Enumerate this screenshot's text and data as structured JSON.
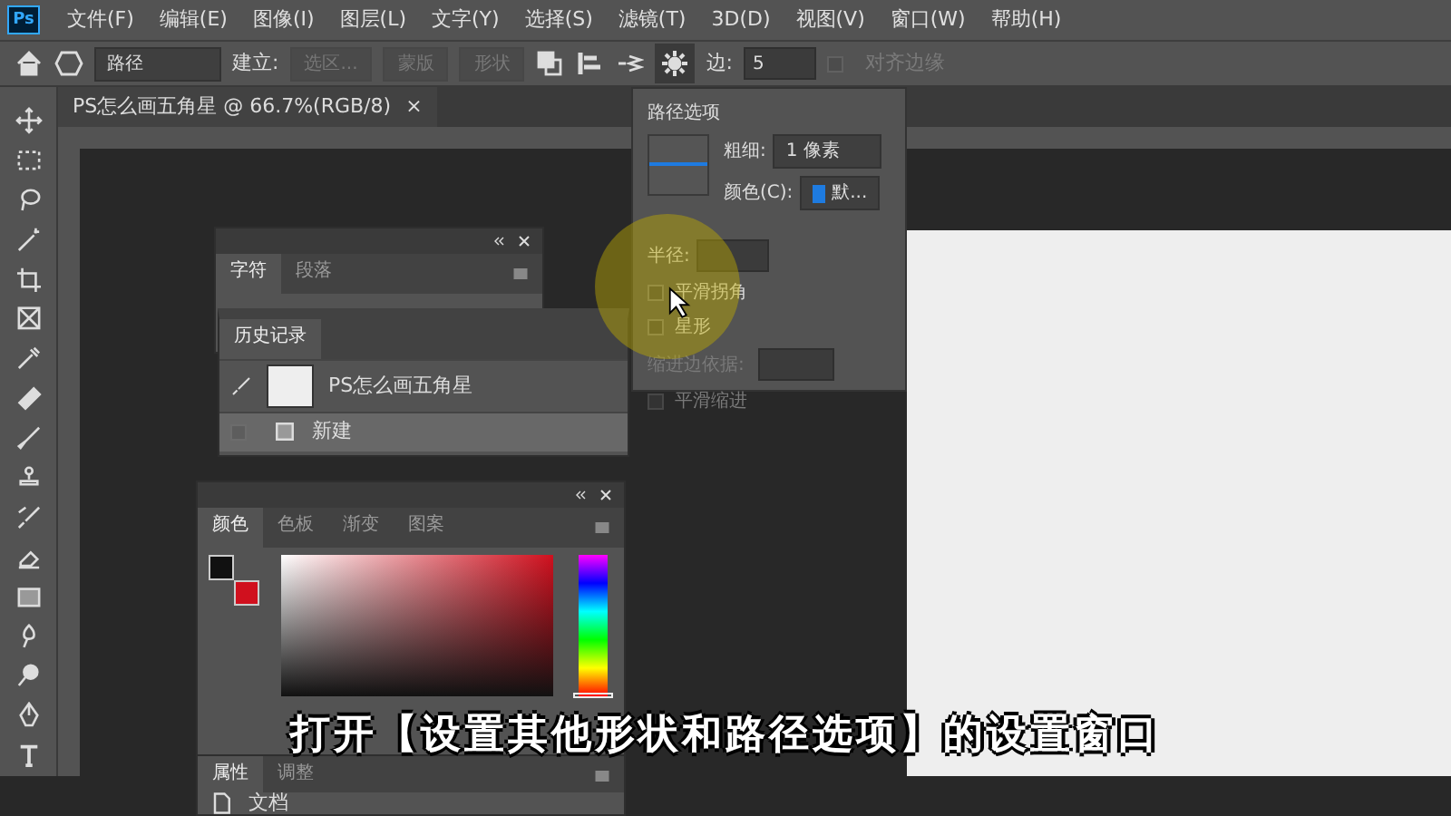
{
  "app_logo": "Ps",
  "menu": [
    "文件(F)",
    "编辑(E)",
    "图像(I)",
    "图层(L)",
    "文字(Y)",
    "选择(S)",
    "滤镜(T)",
    "3D(D)",
    "视图(V)",
    "窗口(W)",
    "帮助(H)"
  ],
  "options_bar": {
    "mode": "路径",
    "build_label": "建立:",
    "build_buttons": [
      "选区...",
      "蒙版",
      "形状"
    ],
    "sides_label": "边:",
    "sides_value": "5",
    "align_edges": {
      "label": "对齐边缘",
      "checked": false,
      "disabled": true
    }
  },
  "document_tab": {
    "title": "PS怎么画五角星 @ 66.7%(RGB/8)",
    "close": "×"
  },
  "path_options": {
    "title": "路径选项",
    "weight_label": "粗细:",
    "weight_value": "1 像素",
    "color_label": "颜色(C):",
    "color_value": "默...",
    "color": "#1e7be0",
    "radius_label": "半径:",
    "options": [
      {
        "kind": "check",
        "label": "平滑拐角",
        "checked": false,
        "disabled": false
      },
      {
        "kind": "check",
        "label": "星形",
        "checked": false,
        "disabled": false
      },
      {
        "kind": "field",
        "label": "缩进边依据:",
        "disabled": true
      },
      {
        "kind": "check",
        "label": "平滑缩进",
        "checked": false,
        "disabled": true
      }
    ]
  },
  "character_panel": {
    "tabs": [
      {
        "label": "字符",
        "selected": true
      },
      {
        "label": "段落",
        "selected": false
      }
    ]
  },
  "history_panel": {
    "tab": "历史记录",
    "entries": [
      {
        "kind": "snapshot",
        "label": "PS怎么画五角星",
        "selected": false
      },
      {
        "kind": "step",
        "label": "新建",
        "selected": true
      }
    ]
  },
  "color_panel": {
    "tabs": [
      {
        "label": "颜色",
        "selected": true
      },
      {
        "label": "色板",
        "selected": false
      },
      {
        "label": "渐变",
        "selected": false
      },
      {
        "label": "图案",
        "selected": false
      }
    ],
    "swatches": [
      {
        "kind": "background",
        "color": "#d0101e"
      },
      {
        "kind": "foreground",
        "color": "#111111"
      }
    ],
    "hue_slider": {
      "level": 0
    }
  },
  "properties_panel": {
    "tabs": [
      {
        "label": "属性",
        "selected": true
      },
      {
        "label": "调整",
        "selected": false
      }
    ],
    "item": "文档"
  },
  "subtitle": "打开【设置其他形状和路径选项】的设置窗口"
}
